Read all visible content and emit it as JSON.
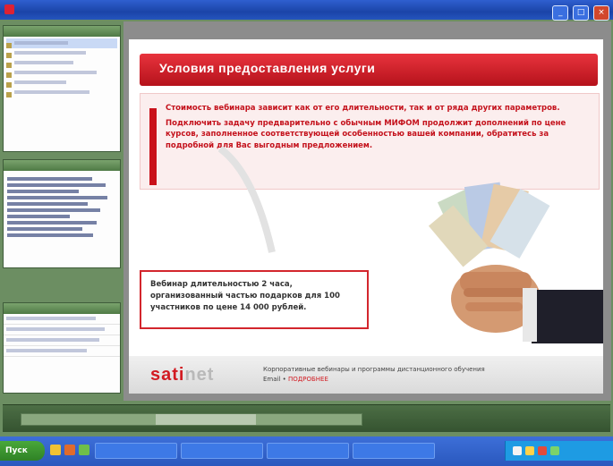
{
  "window": {
    "title": "",
    "buttons": {
      "minimize": "_",
      "maximize": "□",
      "close": "×"
    }
  },
  "left_panes": {
    "slides_pane": {
      "header": "",
      "items": [
        "",
        "",
        "",
        "",
        "",
        ""
      ]
    },
    "outline_pane": {
      "header": ""
    },
    "props_pane": {
      "header": "",
      "rows": [
        "",
        "",
        "",
        ""
      ]
    }
  },
  "slide": {
    "title": "Условия предоставления услуги",
    "paragraphs": [
      "Стоимость вебинара зависит как от его длительности, так и от ряда других параметров.",
      "Подключить задачу предварительно с обычным МИФОМ продолжит дополнений по цене курсов, заполненное соответствующей особенностью вашей компании, обратитесь за подробной для Вас выгодным предложением."
    ],
    "offer_text": "Вебинар длительностью 2 часа, организованный частью подарков для 100 участников по цене 14 000 рублей.",
    "logo": {
      "red": "sati",
      "grey": "net"
    },
    "footer_links": {
      "line1": "Корпоративные вебинары и программы дистанционного обучения",
      "line2_a": "Email • ",
      "line2_b": "ПОДРОБНЕЕ",
      "line2_c": ""
    }
  },
  "notes": {
    "text": ""
  },
  "taskbar": {
    "start_label": "Пуск",
    "buttons": [
      "",
      "",
      "",
      ""
    ],
    "clock": ""
  }
}
